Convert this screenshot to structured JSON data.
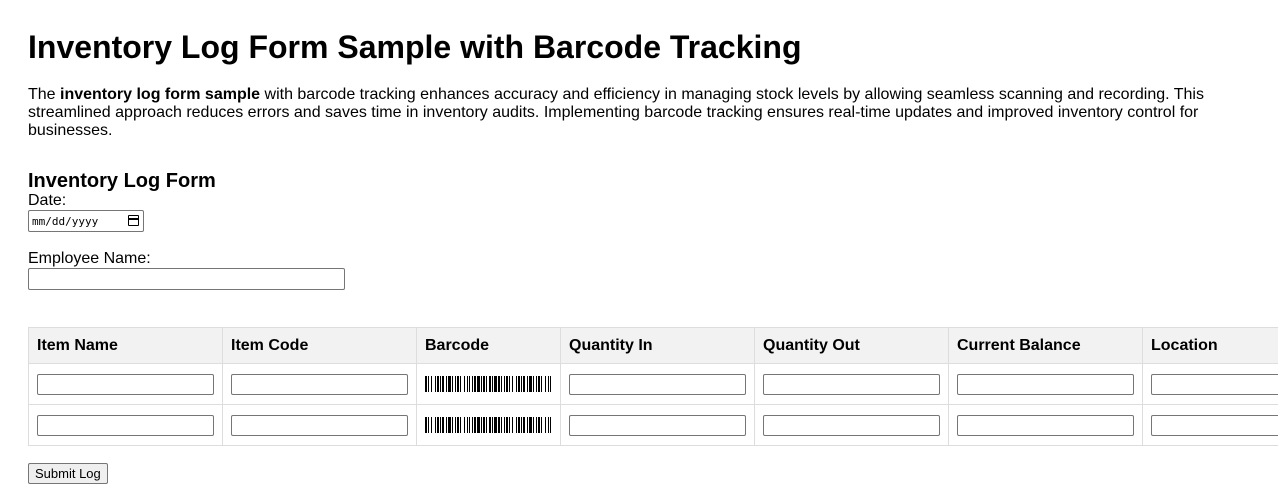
{
  "page": {
    "title": "Inventory Log Form Sample with Barcode Tracking",
    "intro_prefix": "The ",
    "intro_bold": "inventory log form sample",
    "intro_suffix": " with barcode tracking enhances accuracy and efficiency in managing stock levels by allowing seamless scanning and recording. This streamlined approach reduces errors and saves time in inventory audits. Implementing barcode tracking ensures real-time updates and improved inventory control for businesses."
  },
  "form": {
    "heading": "Inventory Log Form",
    "date_label": "Date:",
    "date_value": "mm/dd/yyyy",
    "employee_label": "Employee Name:",
    "employee_value": "",
    "submit_label": "Submit Log"
  },
  "table": {
    "columns": [
      "Item Name",
      "Item Code",
      "Barcode",
      "Quantity In",
      "Quantity Out",
      "Current Balance",
      "Location"
    ],
    "rows": [
      {
        "item_name": "",
        "item_code": "",
        "quantity_in": "",
        "quantity_out": "",
        "current_balance": "",
        "location": ""
      },
      {
        "item_name": "",
        "item_code": "",
        "quantity_in": "",
        "quantity_out": "",
        "current_balance": "",
        "location": ""
      }
    ]
  },
  "icons": {
    "date_picker": "calendar-icon",
    "barcode": "barcode-icon"
  }
}
